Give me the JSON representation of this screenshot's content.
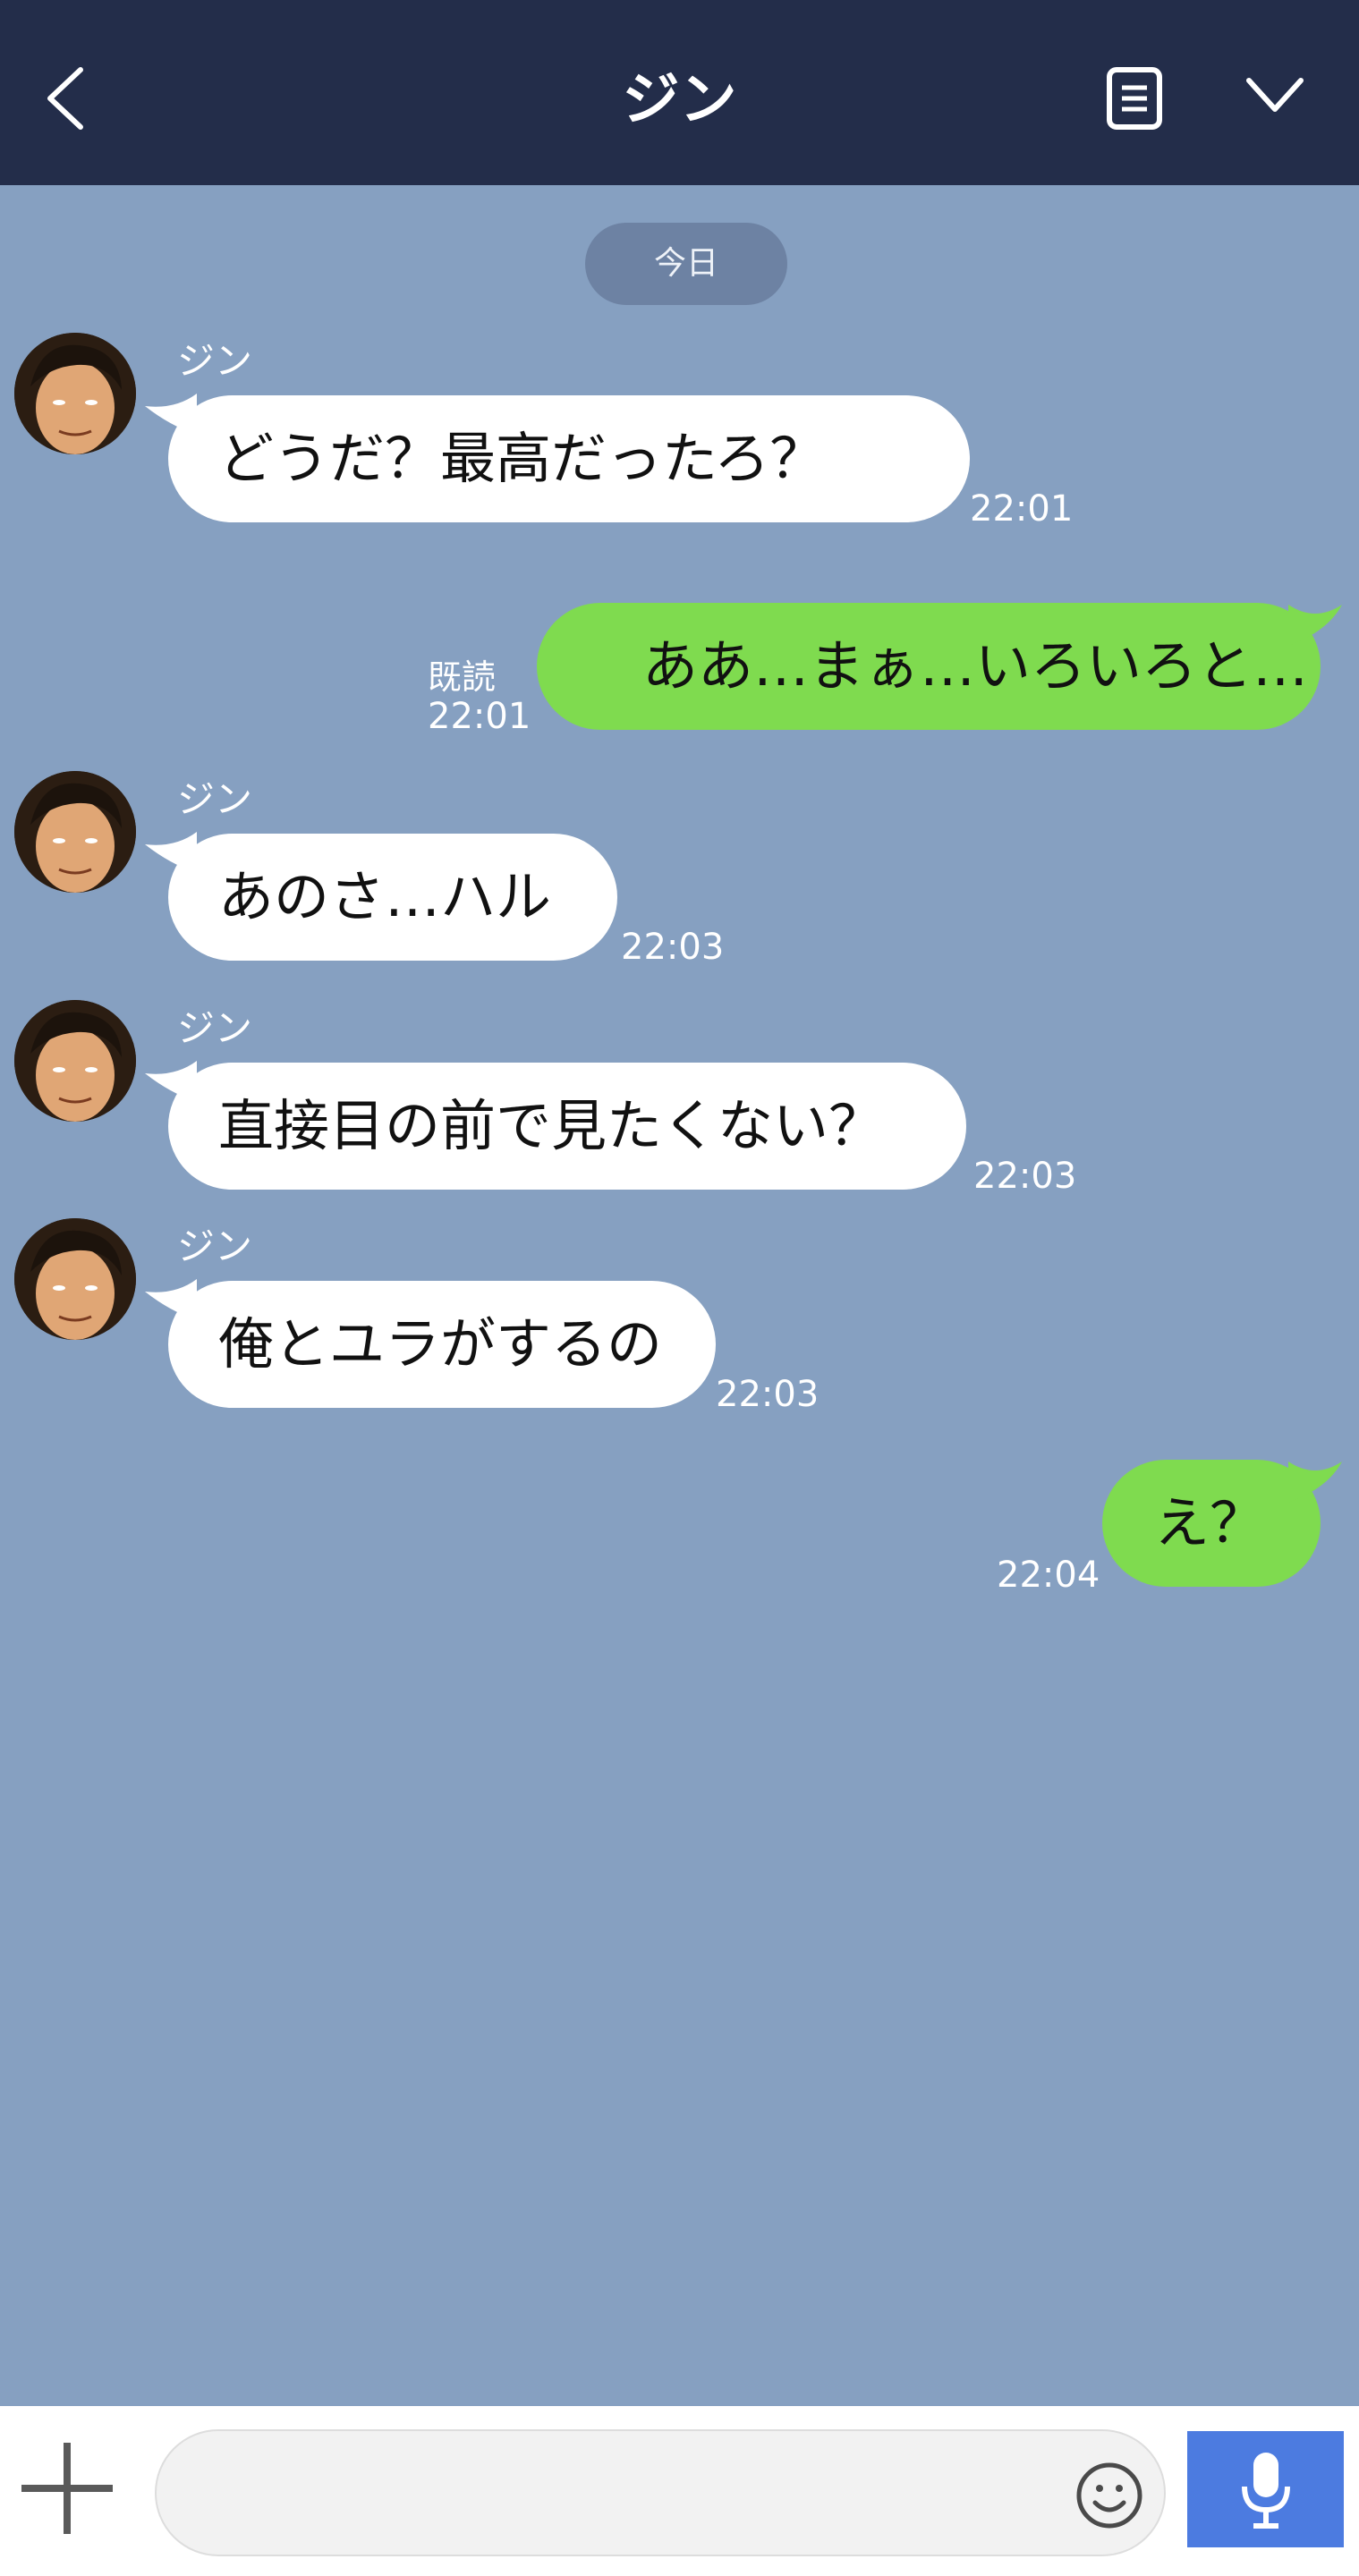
{
  "header": {
    "title": "ジン",
    "back_icon": "chevron-left-icon",
    "notes_icon": "notes-icon",
    "menu_icon": "chevron-down-icon"
  },
  "date_label": "今日",
  "messages": [
    {
      "sender": "ジン",
      "text": "どうだ？最高だったろ？",
      "time": "22:01"
    },
    {
      "sender": "me",
      "text": "ああ…まぁ…いろいろと…",
      "time": "22:01",
      "read": "既読"
    },
    {
      "sender": "ジン",
      "text": "あのさ…ハル",
      "time": "22:03"
    },
    {
      "sender": "ジン",
      "text": "直接目の前で見たくない？",
      "time": "22:03"
    },
    {
      "sender": "ジン",
      "text": "俺とユラがするの",
      "time": "22:03"
    },
    {
      "sender": "me",
      "text": "え？",
      "time": "22:04"
    }
  ],
  "colors": {
    "header_bg": "#232d4a",
    "chat_bg": "#86a0c1",
    "incoming_bubble": "#ffffff",
    "outgoing_bubble": "#7fdb4f",
    "mic_button": "#4c7be0"
  },
  "input": {
    "plus_icon": "plus-icon",
    "emoji_icon": "smiley-icon",
    "mic_icon": "microphone-icon"
  }
}
